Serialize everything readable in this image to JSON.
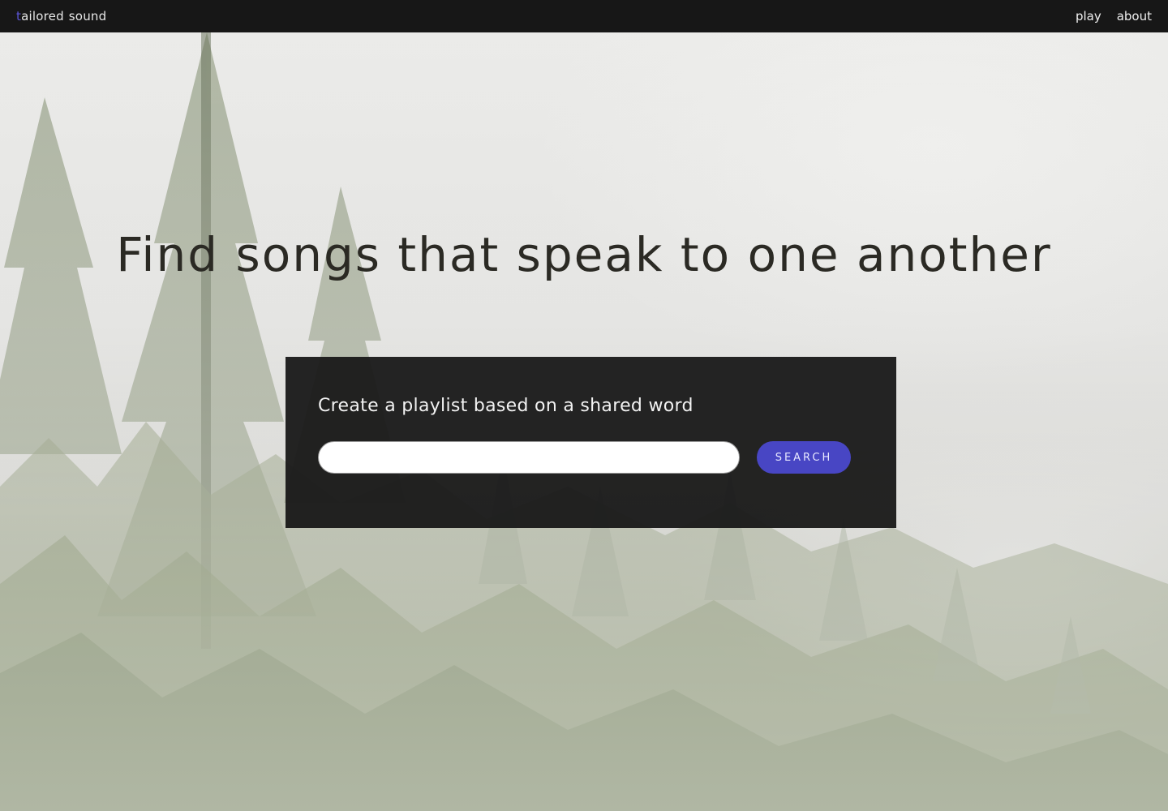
{
  "nav": {
    "brand_initial": "t",
    "brand_rest": "ailored",
    "brand_second": "sound",
    "links": [
      "play",
      "about"
    ]
  },
  "hero": {
    "title": "Find songs that speak to one another"
  },
  "search_panel": {
    "heading": "Create a playlist based on a shared word",
    "input_value": "",
    "input_placeholder": "",
    "button_label": "SEARCH"
  },
  "colors": {
    "topbar": "#171717",
    "accent": "#4846c4",
    "panel": "#181818",
    "hero_text": "#2b2a24"
  },
  "icons": {
    "background": "foggy-forest-image"
  }
}
